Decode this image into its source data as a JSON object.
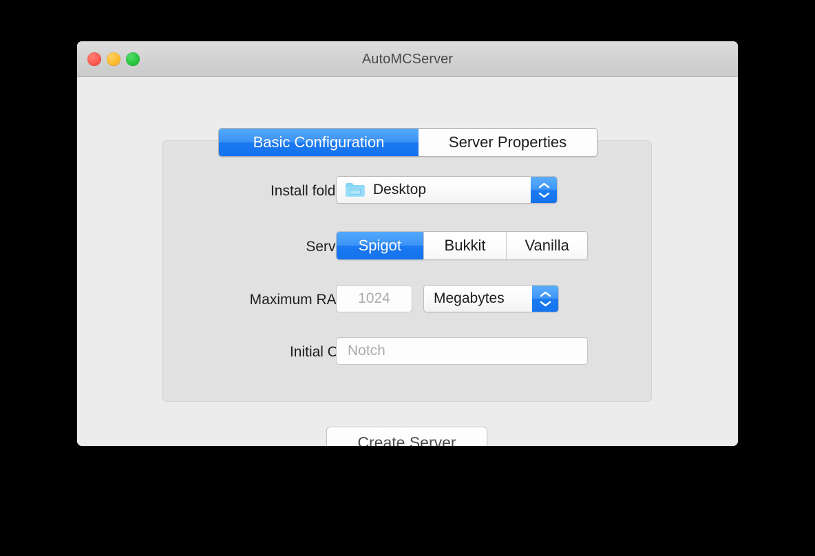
{
  "window": {
    "title": "AutoMCServer",
    "traffic_lights": [
      {
        "name": "close",
        "color": "#FB5A50"
      },
      {
        "name": "minimize",
        "color": "#FCBB2D"
      },
      {
        "name": "zoom",
        "color": "#28C63F"
      }
    ]
  },
  "tabs": [
    {
      "label": "Basic Configuration",
      "selected": true
    },
    {
      "label": "Server Properties",
      "selected": false
    }
  ],
  "form": {
    "install_folder": {
      "label": "Install folder:",
      "value": "Desktop",
      "icon": "folder-icon"
    },
    "server": {
      "label": "Server:",
      "options": [
        "Spigot",
        "Bukkit",
        "Vanilla"
      ],
      "selected": "Spigot"
    },
    "maximum_ram": {
      "label": "Maximum RAM:",
      "placeholder": "1024",
      "value": "",
      "unit_value": "Megabytes"
    },
    "initial_op": {
      "label": "Initial OP:",
      "placeholder": "Notch",
      "value": ""
    }
  },
  "actions": {
    "create_server": "Create Server"
  },
  "colors": {
    "accent_blue": "#1A79F0",
    "window_bg": "#ECECEC",
    "panel_bg": "#E1E1E1",
    "titlebar_bg": "#D3D3D3",
    "folder_blue": "#7FD3F7"
  }
}
